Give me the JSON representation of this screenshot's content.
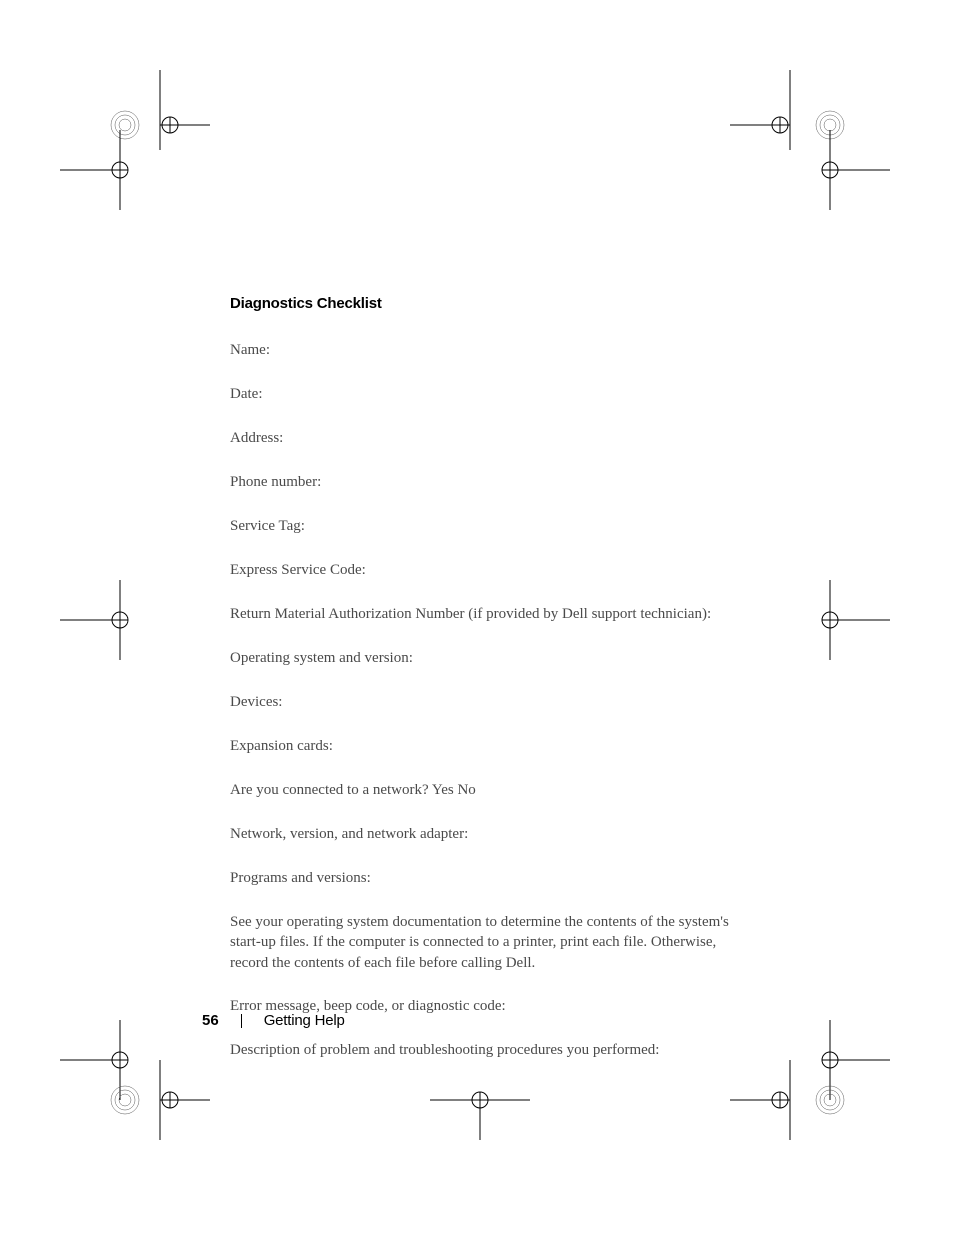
{
  "heading": "Diagnostics Checklist",
  "fields": [
    "Name:",
    "Date:",
    "Address:",
    "Phone number:",
    "Service Tag:",
    "Express Service Code:",
    "Return Material Authorization Number (if provided by Dell support technician):",
    "Operating system and version:",
    "Devices:",
    "Expansion cards:",
    "Are you connected to a network? Yes No",
    "Network, version, and network adapter:",
    "Programs and versions:"
  ],
  "paragraph": "See your operating system documentation to determine the contents of the system's start-up files. If the computer is connected to a printer, print each file. Otherwise, record the contents of each file before calling Dell.",
  "fields2": [
    "Error message, beep code, or diagnostic code:",
    "Description of problem and troubleshooting procedures you performed:"
  ],
  "footer": {
    "page": "56",
    "section": "Getting Help"
  }
}
